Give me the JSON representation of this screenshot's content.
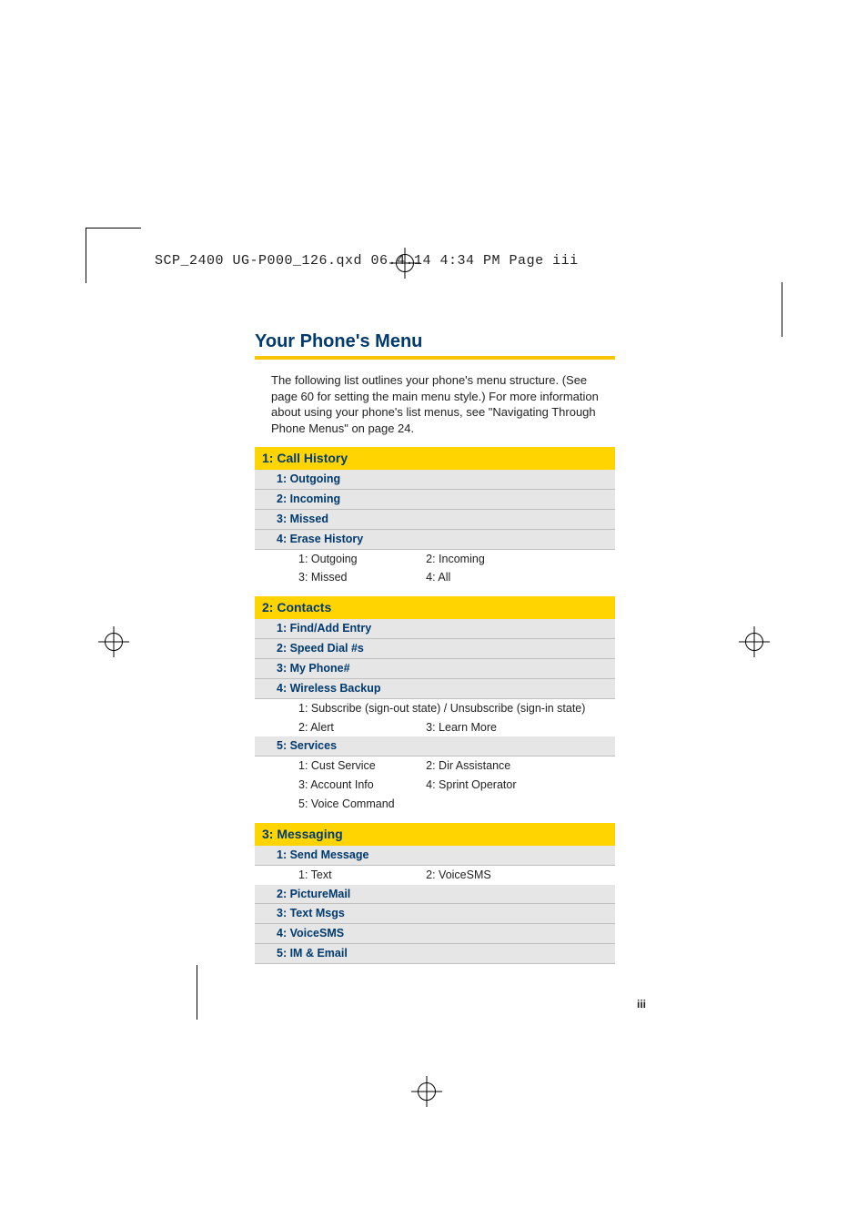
{
  "header": "SCP_2400 UG-P000_126.qxd  06.4.14  4:34 PM  Page iii",
  "title": "Your Phone's Menu",
  "intro": "The following list outlines your phone's menu structure. (See page 60 for setting the main menu style.) For more information about using your phone's list menus, see \"Navigating Through Phone Menus\" on page 24.",
  "page_number": "iii",
  "sections": [
    {
      "head": "1: Call History",
      "rows": [
        {
          "type": "sub",
          "label": "1: Outgoing"
        },
        {
          "type": "sub",
          "label": "2: Incoming"
        },
        {
          "type": "sub",
          "label": "3: Missed"
        },
        {
          "type": "sub",
          "label": "4: Erase History"
        },
        {
          "type": "pair",
          "left": "1: Outgoing",
          "right": "2: Incoming"
        },
        {
          "type": "pair",
          "left": "3: Missed",
          "right": "4: All"
        }
      ]
    },
    {
      "head": "2: Contacts",
      "rows": [
        {
          "type": "sub",
          "label": "1: Find/Add Entry"
        },
        {
          "type": "sub",
          "label": "2: Speed Dial #s"
        },
        {
          "type": "sub",
          "label": "3: My Phone#"
        },
        {
          "type": "sub",
          "label": "4: Wireless Backup"
        },
        {
          "type": "full",
          "label": "1: Subscribe (sign-out state) / Unsubscribe (sign-in state)"
        },
        {
          "type": "pair",
          "left": "2: Alert",
          "right": "3: Learn More"
        },
        {
          "type": "sub",
          "label": "5: Services"
        },
        {
          "type": "pair",
          "left": "1: Cust Service",
          "right": "2: Dir Assistance"
        },
        {
          "type": "pair",
          "left": "3: Account Info",
          "right": "4: Sprint Operator"
        },
        {
          "type": "pair",
          "left": "5: Voice Command",
          "right": ""
        }
      ]
    },
    {
      "head": "3: Messaging",
      "rows": [
        {
          "type": "sub",
          "label": "1: Send Message"
        },
        {
          "type": "pair",
          "left": "1: Text",
          "right": "2: VoiceSMS"
        },
        {
          "type": "sub",
          "label": "2: PictureMail"
        },
        {
          "type": "sub",
          "label": "3: Text Msgs"
        },
        {
          "type": "sub",
          "label": "4: VoiceSMS"
        },
        {
          "type": "sub",
          "label": "5: IM & Email"
        }
      ]
    }
  ]
}
